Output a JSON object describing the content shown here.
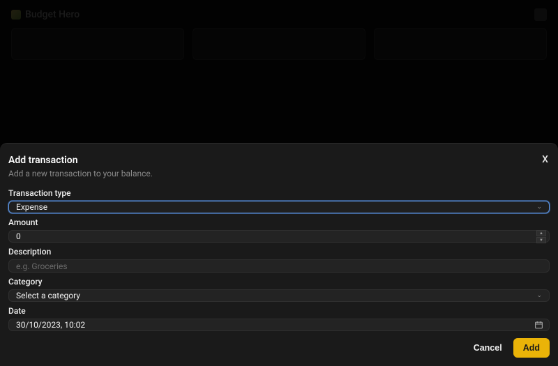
{
  "background": {
    "app_title": "Budget Hero"
  },
  "sheet": {
    "title": "Add transaction",
    "subtitle": "Add a new transaction to your balance.",
    "close_label": "X",
    "fields": {
      "type": {
        "label": "Transaction type",
        "value": "Expense"
      },
      "amount": {
        "label": "Amount",
        "value": "0"
      },
      "description": {
        "label": "Description",
        "placeholder": "e.g. Groceries",
        "value": ""
      },
      "category": {
        "label": "Category",
        "value": "Select a category"
      },
      "date": {
        "label": "Date",
        "value": "30/10/2023, 10:02"
      }
    },
    "buttons": {
      "cancel": "Cancel",
      "add": "Add"
    }
  }
}
